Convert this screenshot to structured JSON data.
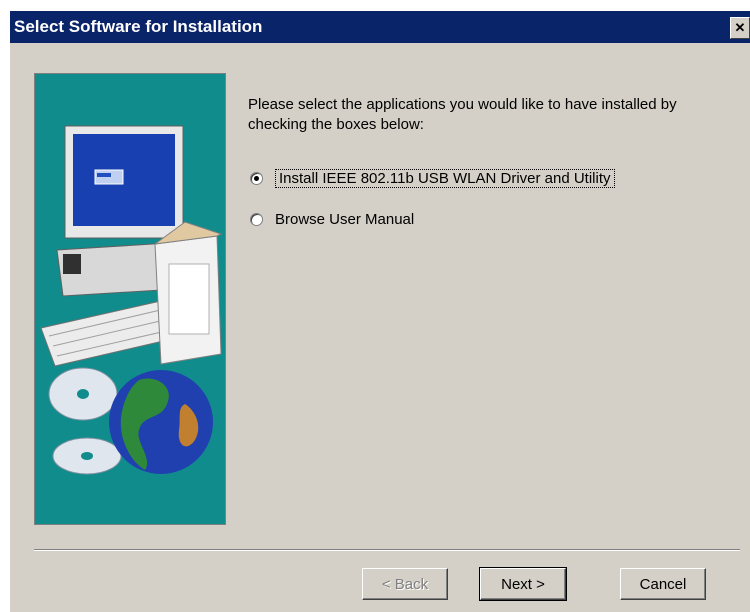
{
  "window": {
    "title": "Select Software for Installation",
    "close_glyph": "✕"
  },
  "instructions": "Please select the applications you would like to have installed by checking the boxes below:",
  "options": [
    {
      "label": "Install IEEE 802.11b USB WLAN Driver and Utility",
      "selected": true
    },
    {
      "label": "Browse User Manual",
      "selected": false
    }
  ],
  "buttons": {
    "back": "< Back",
    "next": "Next >",
    "cancel": "Cancel"
  },
  "colors": {
    "title_bar": "#0a246a",
    "dialog_bg": "#d4d0c8",
    "side_panel": "#108c8c"
  },
  "icons": {
    "side_art": "computer-and-globe-illustration"
  }
}
